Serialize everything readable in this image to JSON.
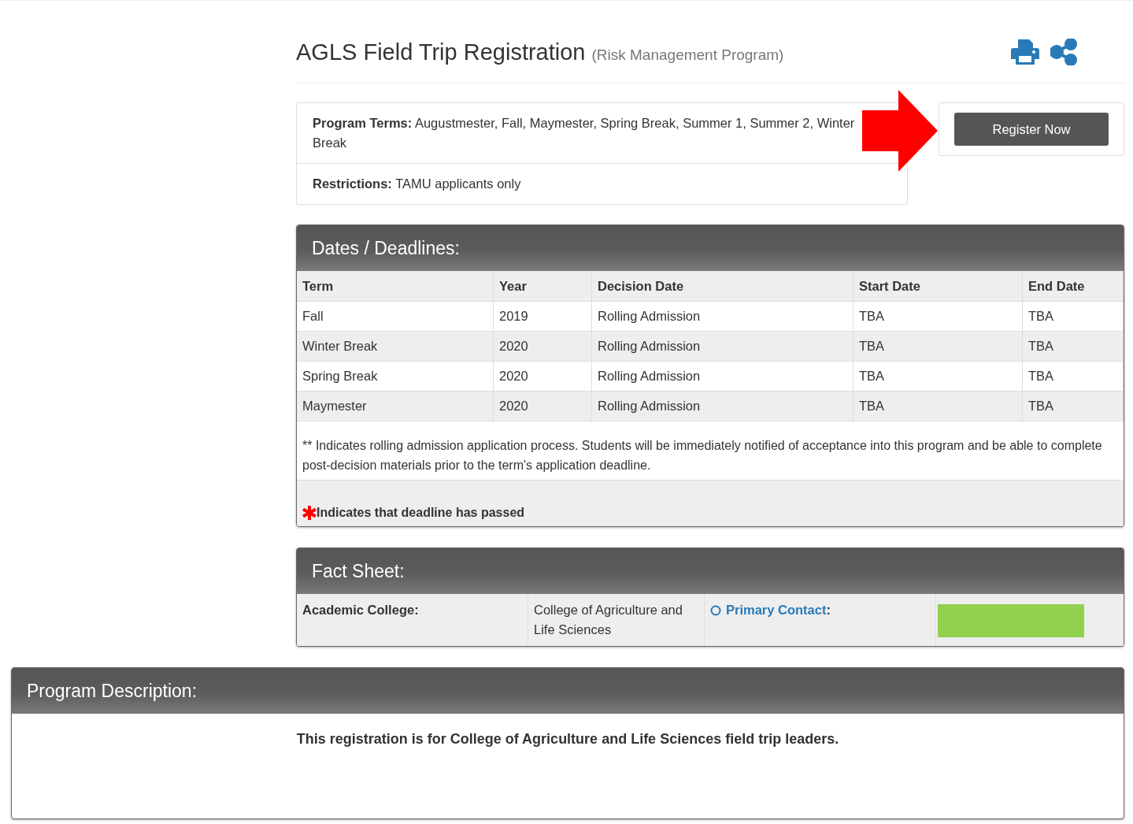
{
  "header": {
    "title": "AGLS Field Trip Registration",
    "subtitle": "(Risk Management Program)"
  },
  "info": [
    {
      "label": "Program Terms:",
      "value": "Augustmester, Fall, Maymester, Spring Break, Summer 1, Summer 2, Winter Break"
    },
    {
      "label": "Restrictions:",
      "value": "TAMU applicants only"
    }
  ],
  "register_button": "Register Now",
  "deadlines": {
    "title": "Dates / Deadlines:",
    "columns": [
      "Term",
      "Year",
      "Decision Date",
      "Start Date",
      "End Date"
    ],
    "rows": [
      {
        "cells": [
          "Fall",
          "2019",
          "Rolling Admission",
          "TBA",
          "TBA"
        ]
      },
      {
        "cells": [
          "Winter Break",
          "2020",
          "Rolling Admission",
          "TBA",
          "TBA"
        ]
      },
      {
        "cells": [
          "Spring Break",
          "2020",
          "Rolling Admission",
          "TBA",
          "TBA"
        ]
      },
      {
        "cells": [
          "Maymester",
          "2020",
          "Rolling Admission",
          "TBA",
          "TBA"
        ]
      }
    ],
    "note": "** Indicates rolling admission application process. Students will be immediately notified of acceptance into this program and be able to complete post-decision materials prior to the term's application deadline.",
    "legend": "Indicates that deadline has passed"
  },
  "fact_sheet": {
    "title": "Fact Sheet:",
    "college_label": "Academic College:",
    "college_value": "College of Agriculture and Life Sciences",
    "contact_label": "Primary Contact",
    "contact_colon": ":"
  },
  "description": {
    "title": "Program Description:",
    "text": "This registration is for College of Agriculture and Life Sciences field trip leaders."
  }
}
